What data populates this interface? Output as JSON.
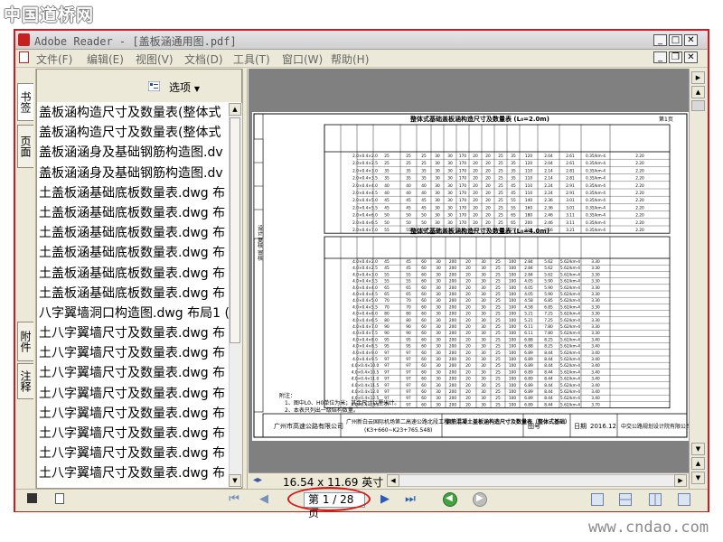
{
  "site_logo": "中国道桥网",
  "window": {
    "title": "Adobe Reader - [盖板涵通用图.pdf]",
    "controls": {
      "minimize": "_",
      "maximize": "□",
      "close": "✕",
      "restore": "❐"
    }
  },
  "menu": [
    {
      "label": "文件(F)"
    },
    {
      "label": "编辑(E)"
    },
    {
      "label": "视图(V)"
    },
    {
      "label": "文档(D)"
    },
    {
      "label": "工具(T)"
    },
    {
      "label": "窗口(W)"
    },
    {
      "label": "帮助(H)"
    }
  ],
  "nav_tabs": {
    "bookmarks": "书签",
    "pages": "页面",
    "attachments": "附件",
    "comments": "注释"
  },
  "panel": {
    "options_label": "选项",
    "bookmarks": [
      "盖板涵构造尺寸及数量表(整体式",
      "盖板涵构造尺寸及数量表(整体式",
      "盖板涵涵身及基础钢筋构造图.dv",
      "盖板涵涵身及基础钢筋构造图.dv",
      "土盖板涵基础底板数量表.dwg 布",
      "土盖板涵基础底板数量表.dwg 布",
      "土盖板涵基础底板数量表.dwg 布",
      "土盖板涵基础底板数量表.dwg 布",
      "土盖板涵基础底板数量表.dwg 布",
      "土盖板涵基础底板数量表.dwg 布",
      "八字翼墙洞口构造图.dwg 布局1 (",
      "土八字翼墙尺寸及数量表.dwg 布",
      "土八字翼墙尺寸及数量表.dwg 布",
      "土八字翼墙尺寸及数量表.dwg 布",
      "土八字翼墙尺寸及数量表.dwg 布",
      "土八字翼墙尺寸及数量表.dwg 布",
      "土八字翼墙尺寸及数量表.dwg 布",
      "土八字翼墙尺寸及数量表.dwg 布",
      "土八字翼墙尺寸及数量表.dwg 布"
    ]
  },
  "document": {
    "page_size": "16.54 x 11.69 英寸",
    "sheet": {
      "title1": "整体式基础盖板涵构造尺寸及数量表 (L₀=2.0m)",
      "title2": "整体式基础盖板涵构造尺寸及数量表 (L₀=4.0m)",
      "page_no": "第1页",
      "notes_label": "附注：",
      "note1": "1、图中L0、H0单位为米；其余尺寸以厘米计。",
      "note2": "2、本表只列出一级结构数量。",
      "footer_company": "广州市高速公路有限公司",
      "footer_project": "广州新白云国际机场第二高速公路北段工程",
      "footer_range": "(K3+660~K23+765.548)",
      "footer_drawing": "钢筋混凝土盖板涵构造尺寸及数量表（整体式基础）",
      "footer_figno": "图号",
      "footer_date_label": "日期",
      "footer_date": "2016.12",
      "footer_designer": "中交公路规划设计院有限公司",
      "side_text": "设计 复核 审核",
      "rows_top": [
        [
          "2.0×0.4×2.0",
          "25",
          "25",
          "25",
          "30",
          "30",
          "170",
          "20",
          "20",
          "25",
          "35",
          "120",
          "2.04",
          "2.61",
          "0.35/km-4",
          "2.20"
        ],
        [
          "2.0×0.4×2.5",
          "25",
          "25",
          "25",
          "30",
          "30",
          "170",
          "20",
          "20",
          "25",
          "35",
          "120",
          "2.04",
          "2.61",
          "0.35/km-4",
          "2.20"
        ],
        [
          "2.0×0.4×3.0",
          "35",
          "35",
          "35",
          "30",
          "30",
          "170",
          "20",
          "20",
          "25",
          "35",
          "110",
          "2.14",
          "2.81",
          "0.35/km-4",
          "2.20"
        ],
        [
          "2.0×0.4×3.5",
          "35",
          "35",
          "35",
          "30",
          "30",
          "170",
          "20",
          "20",
          "25",
          "35",
          "110",
          "2.14",
          "2.81",
          "0.35/km-4",
          "2.20"
        ],
        [
          "2.0×0.4×4.0",
          "40",
          "40",
          "40",
          "30",
          "30",
          "170",
          "20",
          "20",
          "25",
          "45",
          "110",
          "2.24",
          "2.91",
          "0.35/km-4",
          "2.20"
        ],
        [
          "2.0×0.4×4.5",
          "40",
          "40",
          "40",
          "30",
          "30",
          "170",
          "20",
          "20",
          "25",
          "45",
          "110",
          "2.24",
          "2.91",
          "0.35/km-4",
          "2.20"
        ],
        [
          "2.0×0.4×5.0",
          "45",
          "45",
          "45",
          "30",
          "30",
          "170",
          "20",
          "20",
          "25",
          "55",
          "140",
          "2.36",
          "3.01",
          "0.35/km-4",
          "2.20"
        ],
        [
          "2.0×0.4×5.5",
          "45",
          "45",
          "45",
          "30",
          "30",
          "170",
          "20",
          "20",
          "25",
          "55",
          "160",
          "2.36",
          "3.01",
          "0.35/km-4",
          "2.20"
        ],
        [
          "2.0×0.4×6.0",
          "50",
          "50",
          "50",
          "30",
          "30",
          "170",
          "20",
          "20",
          "25",
          "65",
          "180",
          "2.46",
          "3.11",
          "0.35/km-4",
          "2.20"
        ],
        [
          "2.0×0.4×6.5",
          "50",
          "50",
          "50",
          "30",
          "30",
          "170",
          "20",
          "20",
          "25",
          "65",
          "200",
          "2.46",
          "3.11",
          "0.35/km-4",
          "2.20"
        ],
        [
          "2.0×0.4×7.0",
          "55",
          "55",
          "55",
          "30",
          "30",
          "170",
          "20",
          "20",
          "25",
          "75",
          "220",
          "2.56",
          "3.21",
          "0.35/km-4",
          "2.20"
        ]
      ],
      "rows_bottom": [
        [
          "4.0×0.4×2.0",
          "45",
          "45",
          "60",
          "30",
          "200",
          "20",
          "30",
          "25",
          "100",
          "2.84",
          "5.62",
          "5.62/km-4",
          "3.30"
        ],
        [
          "4.0×0.4×2.5",
          "45",
          "45",
          "60",
          "30",
          "200",
          "20",
          "30",
          "25",
          "100",
          "2.84",
          "5.62",
          "5.62/km-4",
          "3.30"
        ],
        [
          "4.0×0.4×3.0",
          "55",
          "55",
          "60",
          "30",
          "200",
          "20",
          "30",
          "25",
          "100",
          "2.84",
          "5.62",
          "5.62/km-4",
          "3.30"
        ],
        [
          "4.0×0.4×3.5",
          "55",
          "55",
          "60",
          "30",
          "200",
          "20",
          "30",
          "25",
          "100",
          "4.05",
          "5.90",
          "5.62/km-4",
          "3.30"
        ],
        [
          "4.0×0.4×4.0",
          "65",
          "65",
          "60",
          "30",
          "200",
          "20",
          "30",
          "25",
          "100",
          "4.05",
          "5.90",
          "5.62/km-4",
          "3.30"
        ],
        [
          "4.0×0.4×4.5",
          "65",
          "65",
          "60",
          "30",
          "200",
          "20",
          "30",
          "25",
          "100",
          "4.05",
          "5.90",
          "5.62/km-4",
          "3.30"
        ],
        [
          "4.0×0.4×5.0",
          "70",
          "70",
          "60",
          "30",
          "200",
          "20",
          "30",
          "25",
          "100",
          "4.58",
          "6.85",
          "5.62/km-4",
          "3.30"
        ],
        [
          "4.0×0.4×5.5",
          "70",
          "70",
          "60",
          "30",
          "200",
          "20",
          "30",
          "25",
          "100",
          "4.58",
          "6.85",
          "5.62/km-4",
          "3.30"
        ],
        [
          "4.0×0.4×6.0",
          "80",
          "80",
          "60",
          "30",
          "200",
          "20",
          "30",
          "25",
          "100",
          "5.21",
          "7.25",
          "5.62/km-4",
          "3.30"
        ],
        [
          "4.0×0.4×6.5",
          "80",
          "80",
          "60",
          "30",
          "200",
          "20",
          "30",
          "25",
          "100",
          "5.21",
          "7.25",
          "5.62/km-4",
          "3.30"
        ],
        [
          "4.0×0.4×7.0",
          "90",
          "90",
          "60",
          "30",
          "200",
          "20",
          "30",
          "25",
          "100",
          "6.11",
          "7.80",
          "5.62/km-4",
          "3.30"
        ],
        [
          "4.0×0.4×7.5",
          "90",
          "90",
          "60",
          "30",
          "200",
          "20",
          "30",
          "25",
          "100",
          "6.11",
          "7.80",
          "5.62/km-4",
          "3.30"
        ],
        [
          "4.0×0.4×8.0",
          "95",
          "95",
          "60",
          "30",
          "200",
          "20",
          "30",
          "25",
          "100",
          "6.88",
          "8.25",
          "5.62/km-4",
          "3.40"
        ],
        [
          "4.0×0.4×8.5",
          "95",
          "95",
          "60",
          "30",
          "200",
          "20",
          "30",
          "25",
          "100",
          "6.88",
          "8.25",
          "5.62/km-4",
          "3.40"
        ],
        [
          "4.0×0.4×9.0",
          "97",
          "97",
          "60",
          "30",
          "200",
          "20",
          "30",
          "25",
          "100",
          "6.89",
          "8.44",
          "5.62/km-4",
          "3.40"
        ],
        [
          "4.0×0.4×9.5",
          "97",
          "97",
          "60",
          "30",
          "200",
          "20",
          "30",
          "25",
          "100",
          "6.89",
          "8.44",
          "5.62/km-4",
          "3.40"
        ],
        [
          "4.0×0.4×10.0",
          "97",
          "97",
          "60",
          "30",
          "200",
          "20",
          "30",
          "25",
          "100",
          "6.89",
          "8.44",
          "5.62/km-4",
          "3.40"
        ],
        [
          "4.0×0.4×10.5",
          "97",
          "97",
          "60",
          "30",
          "200",
          "20",
          "30",
          "25",
          "100",
          "6.89",
          "8.44",
          "5.62/km-4",
          "3.40"
        ],
        [
          "4.0×0.4×11.0",
          "97",
          "97",
          "60",
          "30",
          "200",
          "20",
          "30",
          "25",
          "100",
          "6.89",
          "8.44",
          "5.62/km-4",
          "3.40"
        ],
        [
          "4.0×0.4×11.5",
          "97",
          "97",
          "60",
          "30",
          "200",
          "20",
          "30",
          "25",
          "100",
          "6.89",
          "8.44",
          "5.62/km-4",
          "3.40"
        ],
        [
          "4.0×0.4×12.0",
          "97",
          "97",
          "60",
          "30",
          "200",
          "20",
          "30",
          "25",
          "100",
          "6.89",
          "8.44",
          "5.62/km-4",
          "3.40"
        ],
        [
          "4.0×0.4×12.5",
          "97",
          "97",
          "60",
          "30",
          "200",
          "20",
          "30",
          "25",
          "100",
          "6.89",
          "8.44",
          "5.62/km-4",
          "3.40"
        ],
        [
          "4.0×0.4×13.0",
          "97",
          "97",
          "60",
          "30",
          "200",
          "20",
          "30",
          "25",
          "100",
          "6.89",
          "8.44",
          "5.62/km-4",
          "3.70"
        ]
      ]
    }
  },
  "navigation": {
    "page_display": "第 1 / 28 页"
  },
  "watermark": "www.cndao.com",
  "colors": {
    "highlight": "#d81818",
    "accent": "#c81f1f"
  }
}
